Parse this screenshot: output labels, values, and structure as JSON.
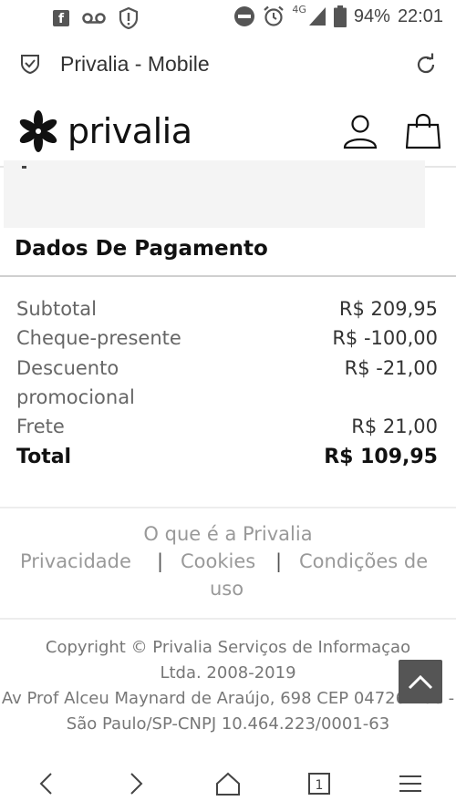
{
  "status_bar": {
    "network": "4G",
    "battery": "94%",
    "time": "22:01"
  },
  "browser": {
    "title": "Privalia - Mobile"
  },
  "site": {
    "logo_text": "privalia"
  },
  "payment": {
    "title": "Dados De Pagamento",
    "rows": [
      {
        "label": "Subtotal",
        "value": "R$ 209,95"
      },
      {
        "label": "Cheque-presente",
        "value": "R$ -100,00"
      },
      {
        "label": "Descuento promocional",
        "value": "R$ -21,00"
      },
      {
        "label": "Frete",
        "value": "R$ 21,00"
      }
    ],
    "total": {
      "label": "Total",
      "value": "R$ 109,95"
    }
  },
  "footer": {
    "what_is": "O que é a Privalia",
    "privacy": "Privacidade",
    "separator": "|",
    "cookies": "Cookies",
    "conditions_a": "Condições de",
    "conditions_b": "uso",
    "copyright_1": "Copyright © Privalia Serviços de Informaçao",
    "copyright_2": "Ltda. 2008-2019",
    "copyright_3": "Av Prof Alceu Maynard de Araújo, 698 CEP 04726-160 -",
    "copyright_4": "São Paulo/SP-CNPJ 10.464.223/0001-63"
  },
  "nav": {
    "tab_count": "1"
  },
  "colors": {
    "text_dark": "#111111",
    "text_muted": "#999999",
    "back_to_top": "#555555"
  },
  "icons": [
    "facebook-icon",
    "voicemail-icon",
    "alert-icon",
    "dnd-icon",
    "alarm-icon",
    "signal-icon",
    "battery-icon",
    "shield-icon",
    "reload-icon",
    "user-icon",
    "bag-icon",
    "chevron-up-icon",
    "back-icon",
    "forward-icon",
    "home-icon",
    "tabs-icon",
    "menu-icon"
  ]
}
